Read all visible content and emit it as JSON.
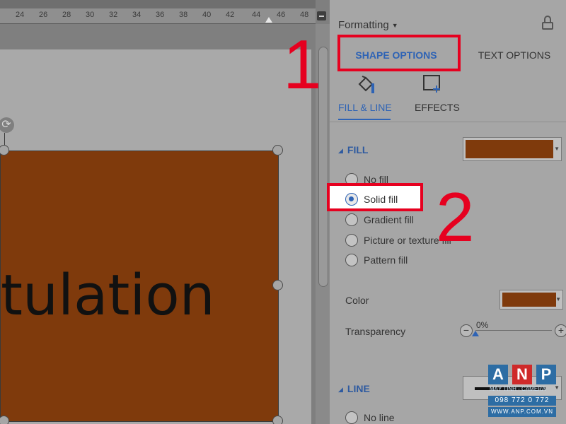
{
  "ruler": {
    "ticks": [
      "24",
      "26",
      "28",
      "30",
      "32",
      "34",
      "36",
      "38",
      "40",
      "42",
      "44",
      "46",
      "48"
    ]
  },
  "canvas": {
    "shape_text": "tulation",
    "shape_fill": "#7f3a0c"
  },
  "pane": {
    "title": "Formatting",
    "tabs": [
      {
        "label": "SHAPE OPTIONS",
        "active": true
      },
      {
        "label": "TEXT OPTIONS",
        "active": false
      }
    ],
    "subtabs": [
      {
        "label": "FILL & LINE",
        "active": true,
        "icon": "paint-bucket-icon"
      },
      {
        "label": "EFFECTS",
        "active": false,
        "icon": "effects-icon"
      }
    ],
    "fill": {
      "heading": "FILL",
      "options": [
        {
          "label": "No fill",
          "selected": false
        },
        {
          "label": "Solid fill",
          "selected": true
        },
        {
          "label": "Gradient fill",
          "selected": false
        },
        {
          "label": "Picture or texture fill",
          "selected": false
        },
        {
          "label": "Pattern fill",
          "selected": false
        }
      ],
      "color_label": "Color",
      "transparency_label": "Transparency",
      "transparency_value": "0%",
      "transparency_fraction": 0,
      "swatch_color": "#7f3a0c"
    },
    "line": {
      "heading": "LINE",
      "options": [
        {
          "label": "No line",
          "selected": false
        }
      ]
    }
  },
  "annotations": {
    "step1": "1",
    "step2": "2",
    "highlight_color": "#e6001f"
  },
  "watermark": {
    "letters": [
      "A",
      "N",
      "P"
    ],
    "tagline": "MÁY TÍNH - CAMERA",
    "phone": "098 772 0 772",
    "website": "WWW.ANP.COM.VN"
  },
  "accent_color": "#2e63b5"
}
